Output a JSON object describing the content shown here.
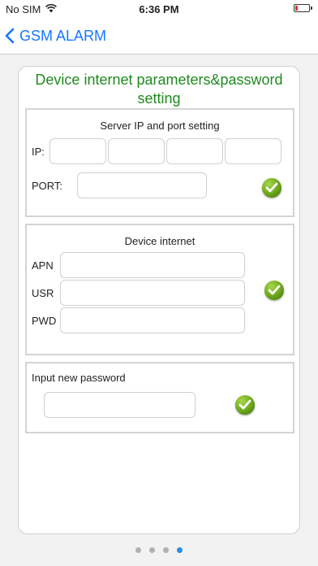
{
  "status_bar": {
    "carrier": "No SIM",
    "time": "6:36 PM",
    "wifi_icon": "wifi-icon",
    "battery_icon": "battery-icon"
  },
  "navbar": {
    "back_label": "GSM ALARM",
    "back_icon": "chevron-left-icon",
    "accent_color": "#1677ff"
  },
  "card": {
    "title": "Device internet parameters&password setting",
    "title_color": "#1f8a1f"
  },
  "server_section": {
    "heading": "Server IP and port setting",
    "ip_label": "IP:",
    "ip_octets": [
      "",
      "",
      "",
      ""
    ],
    "port_label": "PORT:",
    "port_value": "",
    "confirm_icon": "checkmark-icon"
  },
  "internet_section": {
    "heading": "Device internet",
    "apn_label": "APN",
    "apn_value": "",
    "usr_label": "USR",
    "usr_value": "",
    "pwd_label": "PWD",
    "pwd_value": "",
    "confirm_icon": "checkmark-icon"
  },
  "password_section": {
    "heading": "Input new password",
    "password_value": "",
    "confirm_icon": "checkmark-icon"
  },
  "pager": {
    "page_count": 4,
    "current_page": 4,
    "active_color": "#2a8de0"
  }
}
